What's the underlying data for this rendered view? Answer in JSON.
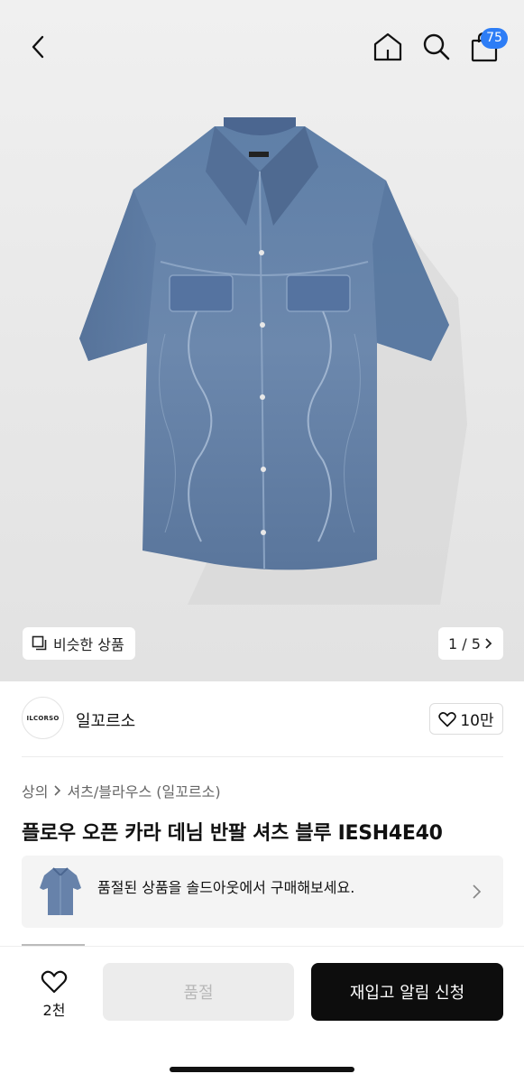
{
  "header": {
    "cart_badge": "75",
    "icons": [
      "chevron-left-icon",
      "home-icon",
      "search-icon",
      "shopping-bag-icon"
    ]
  },
  "gallery": {
    "similar_label": "비슷한 상품",
    "pager_text": "1 / 5"
  },
  "brand": {
    "logo_text": "ILCORSO",
    "name": "일꼬르소",
    "like_count": "10만"
  },
  "breadcrumb": {
    "category": "상의",
    "subcategory": "셔츠/블라우스 (일꼬르소)"
  },
  "product": {
    "title": "플로우 오픈 카라 데님 반팔 셔츠 블루 IESH4E40"
  },
  "banner": {
    "text": "품절된 상품을 솔드아웃에서 구매해보세요."
  },
  "bottom_bar": {
    "wish_count": "2천",
    "soldout_label": "품절",
    "restock_label": "재입고 알림 신청"
  },
  "colors": {
    "badge": "#2d7df6",
    "primary_button": "#0d0d0d",
    "disabled_button": "#ececec"
  }
}
